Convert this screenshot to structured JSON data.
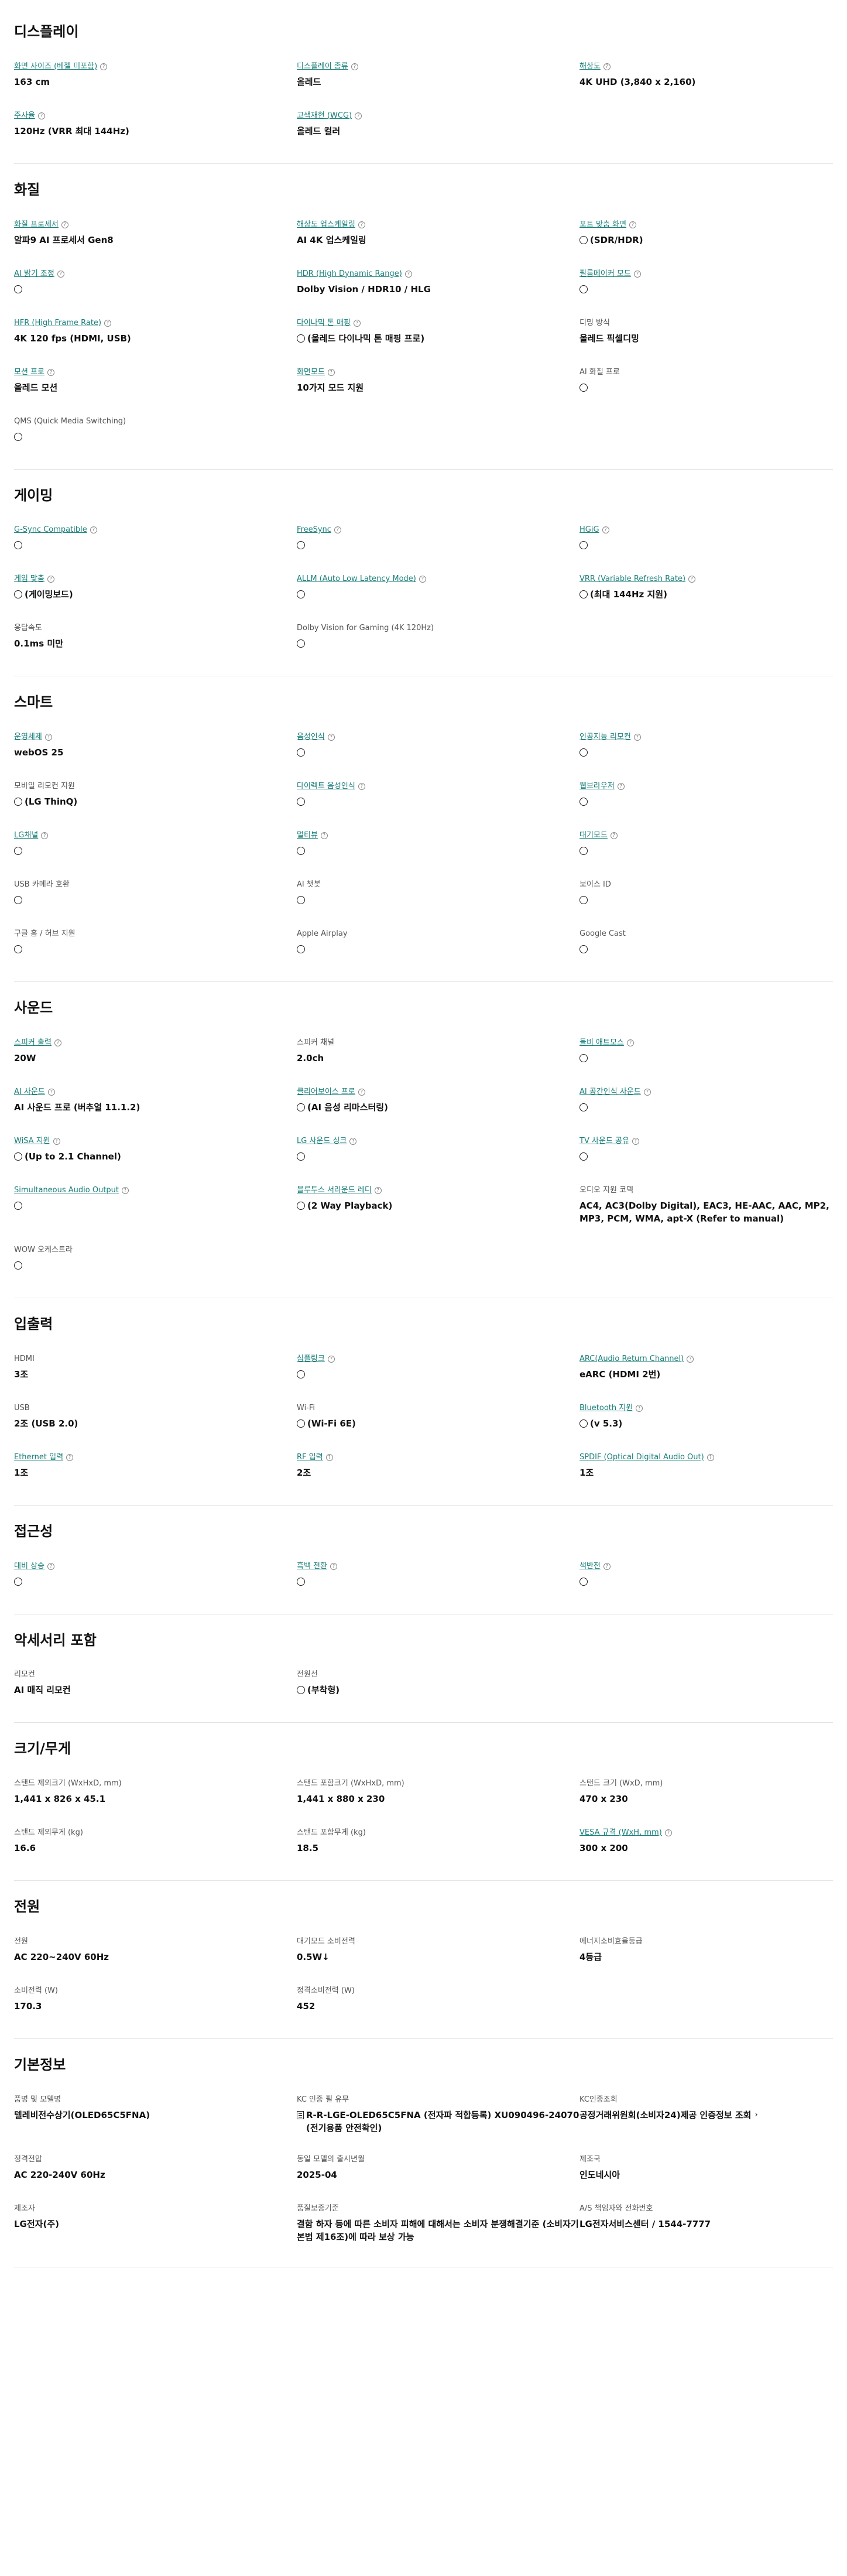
{
  "sections": [
    {
      "title": "디스플레이",
      "items": [
        {
          "label": "화면 사이즈 (베젤 미포함)",
          "link": true,
          "help": true,
          "value": "163 cm",
          "circle": false
        },
        {
          "label": "디스플레이 종류",
          "link": true,
          "help": true,
          "value": "올레드",
          "circle": false
        },
        {
          "label": "해상도",
          "link": true,
          "help": true,
          "value": "4K UHD (3,840 x 2,160)",
          "circle": false
        },
        {
          "label": "주사율",
          "link": true,
          "help": true,
          "value": "120Hz (VRR 최대 144Hz)",
          "circle": false
        },
        {
          "label": "고색재현 (WCG)",
          "link": true,
          "help": true,
          "value": "올레드 컬러",
          "circle": false
        }
      ]
    },
    {
      "title": "화질",
      "items": [
        {
          "label": "화질 프로세서",
          "link": true,
          "help": true,
          "value": "알파9 AI 프로세서 Gen8",
          "circle": false
        },
        {
          "label": "해상도 업스케일링",
          "link": true,
          "help": true,
          "value": "AI 4K 업스케일링",
          "circle": false
        },
        {
          "label": "포트 맞춤 화면",
          "link": true,
          "help": true,
          "value": "(SDR/HDR)",
          "circle": true
        },
        {
          "label": "AI 밝기 조정",
          "link": true,
          "help": true,
          "value": "",
          "circle": true
        },
        {
          "label": "HDR (High Dynamic Range)",
          "link": true,
          "help": true,
          "value": "Dolby Vision / HDR10 / HLG",
          "circle": false
        },
        {
          "label": "필름메이커 모드",
          "link": true,
          "help": true,
          "value": "",
          "circle": true
        },
        {
          "label": "HFR (High Frame Rate)",
          "link": true,
          "help": true,
          "value": "4K 120 fps (HDMI, USB)",
          "circle": false
        },
        {
          "label": "다이나믹 톤 매핑",
          "link": true,
          "help": true,
          "value": "(올레드 다이나믹 톤 매핑 프로)",
          "circle": true
        },
        {
          "label": "디밍 방식",
          "link": false,
          "help": false,
          "value": "올레드 픽셀디밍",
          "circle": false
        },
        {
          "label": "모션 프로",
          "link": true,
          "help": true,
          "value": "올레드 모션",
          "circle": false
        },
        {
          "label": "화면모드",
          "link": true,
          "help": true,
          "value": "10가지 모드 지원",
          "circle": false
        },
        {
          "label": "AI 화질 프로",
          "link": false,
          "help": false,
          "value": "",
          "circle": true
        },
        {
          "label": "QMS (Quick Media Switching)",
          "link": false,
          "help": false,
          "value": "",
          "circle": true
        }
      ]
    },
    {
      "title": "게이밍",
      "items": [
        {
          "label": "G-Sync Compatible",
          "link": true,
          "help": true,
          "value": "",
          "circle": true
        },
        {
          "label": "FreeSync",
          "link": true,
          "help": true,
          "value": "",
          "circle": true
        },
        {
          "label": "HGiG",
          "link": true,
          "help": true,
          "value": "",
          "circle": true
        },
        {
          "label": "게임 맞춤",
          "link": true,
          "help": true,
          "value": "(게이밍보드)",
          "circle": true
        },
        {
          "label": "ALLM (Auto Low Latency Mode)",
          "link": true,
          "help": true,
          "value": "",
          "circle": true
        },
        {
          "label": "VRR (Variable Refresh Rate)",
          "link": true,
          "help": true,
          "value": "(최대 144Hz 지원)",
          "circle": true
        },
        {
          "label": "응답속도",
          "link": false,
          "help": false,
          "value": "0.1ms 미만",
          "circle": false
        },
        {
          "label": "Dolby Vision for Gaming (4K 120Hz)",
          "link": false,
          "help": false,
          "value": "",
          "circle": true
        }
      ]
    },
    {
      "title": "스마트",
      "items": [
        {
          "label": "운영체제",
          "link": true,
          "help": true,
          "value": "webOS 25",
          "circle": false
        },
        {
          "label": "음성인식",
          "link": true,
          "help": true,
          "value": "",
          "circle": true
        },
        {
          "label": "인공지능 리모컨",
          "link": true,
          "help": true,
          "value": "",
          "circle": true
        },
        {
          "label": "모바일 리모컨 지원",
          "link": false,
          "help": false,
          "value": "(LG ThinQ)",
          "circle": true
        },
        {
          "label": "다이렉트 음성인식",
          "link": true,
          "help": true,
          "value": "",
          "circle": true
        },
        {
          "label": "웹브라우저",
          "link": true,
          "help": true,
          "value": "",
          "circle": true
        },
        {
          "label": "LG채널",
          "link": true,
          "help": true,
          "value": "",
          "circle": true
        },
        {
          "label": "멀티뷰",
          "link": true,
          "help": true,
          "value": "",
          "circle": true
        },
        {
          "label": "대기모드",
          "link": true,
          "help": true,
          "value": "",
          "circle": true
        },
        {
          "label": "USB 카메라 호환",
          "link": false,
          "help": false,
          "value": "",
          "circle": true
        },
        {
          "label": "AI 챗봇",
          "link": false,
          "help": false,
          "value": "",
          "circle": true
        },
        {
          "label": "보이스 ID",
          "link": false,
          "help": false,
          "value": "",
          "circle": true
        },
        {
          "label": "구글 홈 / 허브 지원",
          "link": false,
          "help": false,
          "value": "",
          "circle": true
        },
        {
          "label": "Apple Airplay",
          "link": false,
          "help": false,
          "value": "",
          "circle": true
        },
        {
          "label": "Google Cast",
          "link": false,
          "help": false,
          "value": "",
          "circle": true
        }
      ]
    },
    {
      "title": "사운드",
      "items": [
        {
          "label": "스피커 출력",
          "link": true,
          "help": true,
          "value": "20W",
          "circle": false
        },
        {
          "label": "스피커 채널",
          "link": false,
          "help": false,
          "value": "2.0ch",
          "circle": false
        },
        {
          "label": "돌비 애트모스",
          "link": true,
          "help": true,
          "value": "",
          "circle": true
        },
        {
          "label": "AI 사운드",
          "link": true,
          "help": true,
          "value": "AI 사운드 프로 (버추얼 11.1.2)",
          "circle": false
        },
        {
          "label": "클리어보이스 프로",
          "link": true,
          "help": true,
          "value": "(AI 음성 리마스터링)",
          "circle": true
        },
        {
          "label": "AI 공간인식 사운드",
          "link": true,
          "help": true,
          "value": "",
          "circle": true
        },
        {
          "label": "WiSA 지원",
          "link": true,
          "help": true,
          "value": "(Up to 2.1 Channel)",
          "circle": true
        },
        {
          "label": "LG 사운드 싱크",
          "link": true,
          "help": true,
          "value": "",
          "circle": true
        },
        {
          "label": "TV 사운드 공유",
          "link": true,
          "help": true,
          "value": "",
          "circle": true
        },
        {
          "label": "Simultaneous Audio Output",
          "link": true,
          "help": true,
          "value": "",
          "circle": true
        },
        {
          "label": "블루투스 서라운드 레디",
          "link": true,
          "help": true,
          "value": "(2 Way Playback)",
          "circle": true
        },
        {
          "label": "오디오 지원 코덱",
          "link": false,
          "help": false,
          "value": "AC4, AC3(Dolby Digital), EAC3, HE-AAC, AAC, MP2, MP3, PCM, WMA, apt-X (Refer to manual)",
          "circle": false
        },
        {
          "label": "WOW 오케스트라",
          "link": false,
          "help": false,
          "value": "",
          "circle": true
        }
      ]
    },
    {
      "title": "입출력",
      "items": [
        {
          "label": "HDMI",
          "link": false,
          "help": false,
          "value": "3조",
          "circle": false
        },
        {
          "label": "심플링크",
          "link": true,
          "help": true,
          "value": "",
          "circle": true
        },
        {
          "label": "ARC(Audio Return Channel)",
          "link": true,
          "help": true,
          "value": "eARC (HDMI 2번)",
          "circle": false
        },
        {
          "label": "USB",
          "link": false,
          "help": false,
          "value": "2조 (USB 2.0)",
          "circle": false
        },
        {
          "label": "Wi-Fi",
          "link": false,
          "help": false,
          "value": "(Wi-Fi 6E)",
          "circle": true
        },
        {
          "label": "Bluetooth 지원",
          "link": true,
          "help": true,
          "value": "(v 5.3)",
          "circle": true
        },
        {
          "label": "Ethernet 입력",
          "link": true,
          "help": true,
          "value": "1조",
          "circle": false
        },
        {
          "label": "RF 입력",
          "link": true,
          "help": true,
          "value": "2조",
          "circle": false
        },
        {
          "label": "SPDIF (Optical Digital Audio Out)",
          "link": true,
          "help": true,
          "value": "1조",
          "circle": false
        }
      ]
    },
    {
      "title": "접근성",
      "items": [
        {
          "label": "대비 상승",
          "link": true,
          "help": true,
          "value": "",
          "circle": true
        },
        {
          "label": "흑백 전환",
          "link": true,
          "help": true,
          "value": "",
          "circle": true
        },
        {
          "label": "색반전",
          "link": true,
          "help": true,
          "value": "",
          "circle": true
        }
      ]
    },
    {
      "title": "악세서리 포함",
      "items": [
        {
          "label": "리모컨",
          "link": false,
          "help": false,
          "value": "AI 매직 리모컨",
          "circle": false
        },
        {
          "label": "전원선",
          "link": false,
          "help": false,
          "value": "(부착형)",
          "circle": true
        }
      ]
    },
    {
      "title": "크기/무게",
      "items": [
        {
          "label": "스탠드 제외크기 (WxHxD, mm)",
          "link": false,
          "help": false,
          "value": "1,441 x 826 x 45.1",
          "circle": false
        },
        {
          "label": "스탠드 포함크기 (WxHxD, mm)",
          "link": false,
          "help": false,
          "value": "1,441 x 880 x 230",
          "circle": false
        },
        {
          "label": "스탠드 크기 (WxD, mm)",
          "link": false,
          "help": false,
          "value": "470 x 230",
          "circle": false
        },
        {
          "label": "스탠드 제외무게 (kg)",
          "link": false,
          "help": false,
          "value": "16.6",
          "circle": false
        },
        {
          "label": "스탠드 포함무게 (kg)",
          "link": false,
          "help": false,
          "value": "18.5",
          "circle": false
        },
        {
          "label": "VESA 규격 (WxH, mm)",
          "link": true,
          "help": true,
          "value": "300 x 200",
          "circle": false
        }
      ]
    },
    {
      "title": "전원",
      "items": [
        {
          "label": "전원",
          "link": false,
          "help": false,
          "value": "AC 220~240V 60Hz",
          "circle": false
        },
        {
          "label": "대기모드 소비전력",
          "link": false,
          "help": false,
          "value": "0.5W↓",
          "circle": false
        },
        {
          "label": "에너지소비효율등급",
          "link": false,
          "help": false,
          "value": "4등급",
          "circle": false
        },
        {
          "label": "소비전력 (W)",
          "link": false,
          "help": false,
          "value": "170.3",
          "circle": false
        },
        {
          "label": "정격소비전력 (W)",
          "link": false,
          "help": false,
          "value": "452",
          "circle": false
        }
      ]
    },
    {
      "title": "기본정보",
      "items": [
        {
          "label": "품명 및 모델명",
          "link": false,
          "help": false,
          "value": "텔레비전수상기(OLED65C5FNA)",
          "circle": false
        },
        {
          "label": "KC 인증 필 유무",
          "link": false,
          "help": false,
          "value": "R-R-LGE-OLED65C5FNA (전자파 적합등록) XU090496-24070 (전기용품 안전확인)",
          "circle": false,
          "doc": true
        },
        {
          "label": "KC인증조회",
          "link": false,
          "help": false,
          "value": "공정거래위원회(소비자24)제공 인증정보 조회",
          "circle": false,
          "arrow": "›"
        },
        {
          "label": "정격전압",
          "link": false,
          "help": false,
          "value": "AC 220-240V 60Hz",
          "circle": false
        },
        {
          "label": "동일 모델의 출시년월",
          "link": false,
          "help": false,
          "value": "2025-04",
          "circle": false
        },
        {
          "label": "제조국",
          "link": false,
          "help": false,
          "value": "인도네시아",
          "circle": false
        },
        {
          "label": "제조자",
          "link": false,
          "help": false,
          "value": "LG전자(주)",
          "circle": false
        },
        {
          "label": "품질보증기준",
          "link": false,
          "help": false,
          "value": "결함 하자 등에 따른 소비자 피해에 대해서는 소비자 분쟁해결기준 (소비자기본법 제16조)에 따라 보상 가능",
          "circle": false
        },
        {
          "label": "A/S 책임자와 전화번호",
          "link": false,
          "help": false,
          "value": "LG전자서비스센터 / 1544-7777",
          "circle": false
        }
      ]
    }
  ],
  "help_glyph": "?"
}
